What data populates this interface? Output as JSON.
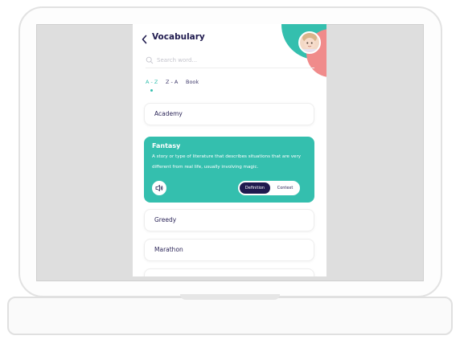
{
  "app": {
    "title": "Vocabulary",
    "search": {
      "placeholder": "Search word..."
    },
    "tabs": [
      {
        "label": "A - Z",
        "active": true
      },
      {
        "label": "Z - A",
        "active": false
      },
      {
        "label": "Book",
        "active": false
      }
    ],
    "words": [
      {
        "word": "Academy"
      },
      {
        "word": "Fantasy",
        "expanded": true,
        "definition": "A story or type of literature that describes situations that are very different from real life, usually involving magic.",
        "toggle": {
          "options": [
            "Definition",
            "Context"
          ],
          "selected": "Definition"
        }
      },
      {
        "word": "Greedy"
      },
      {
        "word": "Marathon"
      }
    ],
    "colors": {
      "accent": "#34bfae",
      "navy": "#1f1a4e",
      "pink": "#f08b8b"
    },
    "icons": [
      "back-arrow-icon",
      "search-icon",
      "speaker-icon",
      "avatar"
    ]
  }
}
